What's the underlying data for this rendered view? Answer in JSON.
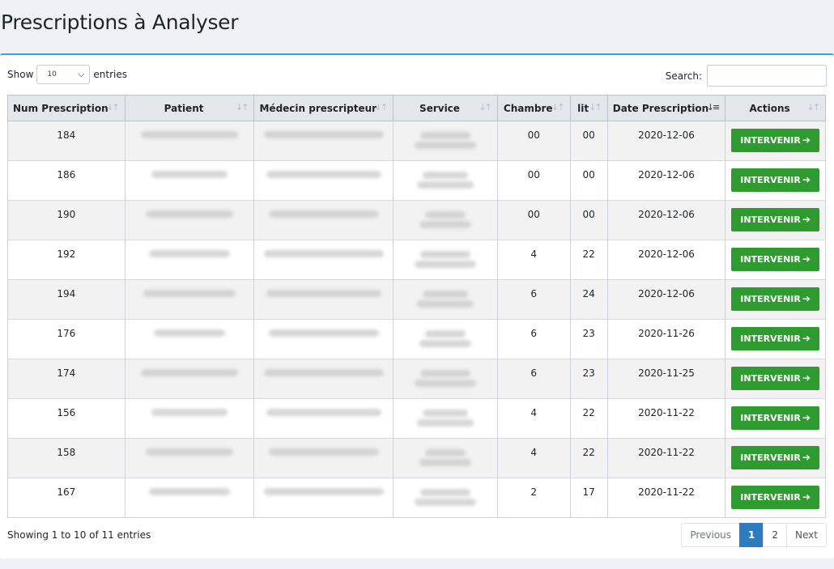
{
  "page": {
    "title": "Prescriptions à Analyser"
  },
  "controls": {
    "show_label": "Show",
    "entries_label": "entries",
    "length_value": "10",
    "search_label": "Search:",
    "search_value": ""
  },
  "table": {
    "columns": [
      "Num Prescription",
      "Patient",
      "Médecin prescripteur",
      "Service",
      "Chambre",
      "lit",
      "Date Prescription",
      "Actions"
    ],
    "action_label": "INTERVENIR",
    "rows": [
      {
        "num": "184",
        "chambre": "00",
        "lit": "00",
        "date": "2020-12-06"
      },
      {
        "num": "186",
        "chambre": "00",
        "lit": "00",
        "date": "2020-12-06"
      },
      {
        "num": "190",
        "chambre": "00",
        "lit": "00",
        "date": "2020-12-06"
      },
      {
        "num": "192",
        "chambre": "4",
        "lit": "22",
        "date": "2020-12-06"
      },
      {
        "num": "194",
        "chambre": "6",
        "lit": "24",
        "date": "2020-12-06"
      },
      {
        "num": "176",
        "chambre": "6",
        "lit": "23",
        "date": "2020-11-26"
      },
      {
        "num": "174",
        "chambre": "6",
        "lit": "23",
        "date": "2020-11-25"
      },
      {
        "num": "156",
        "chambre": "4",
        "lit": "22",
        "date": "2020-11-22"
      },
      {
        "num": "158",
        "chambre": "4",
        "lit": "22",
        "date": "2020-11-22"
      },
      {
        "num": "167",
        "chambre": "2",
        "lit": "17",
        "date": "2020-11-22"
      }
    ]
  },
  "footer": {
    "info": "Showing 1 to 10 of 11 entries",
    "previous": "Previous",
    "page1": "1",
    "page2": "2",
    "next": "Next"
  },
  "colors": {
    "accent": "#3c9ee0",
    "action_button": "#2e9b2e",
    "active_page": "#2d7cc0"
  },
  "icons": {
    "sort": "sort-arrows-icon",
    "sort_active": "sort-desc-icon",
    "action": "arrow-right-icon",
    "select": "chevron-down-icon"
  }
}
